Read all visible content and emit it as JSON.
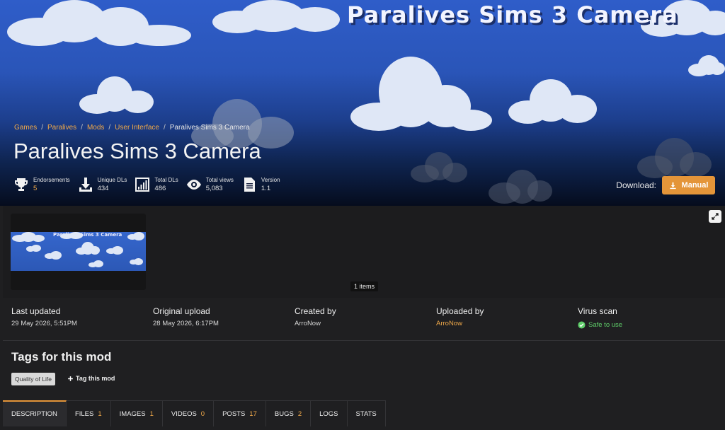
{
  "banner": {
    "art_title": "Paralives Sims 3 Camera"
  },
  "breadcrumb": [
    "Games",
    "Paralives",
    "Mods",
    "User Interface",
    "Paralives Sims 3 Camera"
  ],
  "page_title": "Paralives Sims 3 Camera",
  "stats": [
    {
      "label": "Endorsements",
      "value": "5",
      "icon": "trophy-icon"
    },
    {
      "label": "Unique DLs",
      "value": "434",
      "icon": "download-icon"
    },
    {
      "label": "Total DLs",
      "value": "486",
      "icon": "bar-chart-icon"
    },
    {
      "label": "Total views",
      "value": "5,083",
      "icon": "eye-icon"
    },
    {
      "label": "Version",
      "value": "1.1",
      "icon": "document-icon"
    }
  ],
  "download": {
    "label": "Download:",
    "button": "Manual"
  },
  "gallery": {
    "thumb_title": "Paralives Sims 3 Camera",
    "items_count": "1 items"
  },
  "meta": {
    "last_updated": {
      "label": "Last updated",
      "value": "29 May 2026, 5:51PM"
    },
    "original_upload": {
      "label": "Original upload",
      "value": "28 May 2026, 6:17PM"
    },
    "created_by": {
      "label": "Created by",
      "value": "ArroNow"
    },
    "uploaded_by": {
      "label": "Uploaded by",
      "value": "ArroNow"
    },
    "virus_scan": {
      "label": "Virus scan",
      "value": "Safe to use"
    }
  },
  "tags": {
    "heading": "Tags for this mod",
    "items": [
      "Quality of Life"
    ],
    "add_label": "Tag this mod"
  },
  "tabs": [
    {
      "label": "DESCRIPTION",
      "count": ""
    },
    {
      "label": "FILES",
      "count": "1"
    },
    {
      "label": "IMAGES",
      "count": "1"
    },
    {
      "label": "VIDEOS",
      "count": "0"
    },
    {
      "label": "POSTS",
      "count": "17"
    },
    {
      "label": "BUGS",
      "count": "2"
    },
    {
      "label": "LOGS",
      "count": ""
    },
    {
      "label": "STATS",
      "count": ""
    }
  ],
  "colors": {
    "accent": "#e49539",
    "link": "#f0a94a",
    "safe": "#5fcf6a",
    "background": "#1f1f21"
  }
}
